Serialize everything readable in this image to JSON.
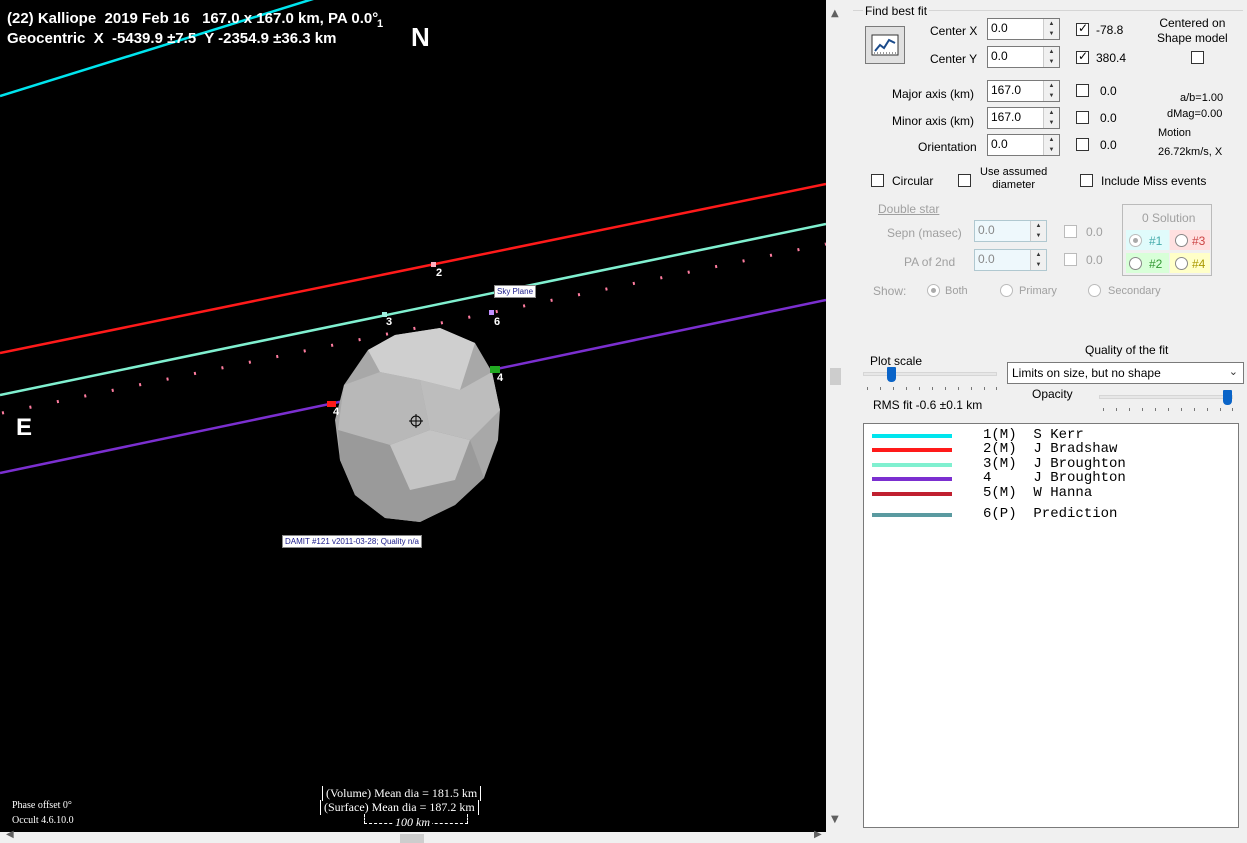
{
  "plot": {
    "header_line1": "(22) Kalliope  2019 Feb 16   167.0 x 167.0 km, PA 0.0°",
    "header_line2": "Geocentric  X  -5439.9 ±7.5  Y -2354.9 ±36.3 km",
    "north": "N",
    "east": "E",
    "sky_plane_label": "Sky Plane",
    "shape_label": "DAMIT #121 v2011-03-28; Quality n/a",
    "chord_labels": [
      "1",
      "2",
      "3",
      "4",
      "4",
      "4",
      "6"
    ],
    "volume_dia": "(Volume) Mean dia = 181.5 km",
    "surface_dia": "(Surface) Mean dia = 187.2 km",
    "scale_bar": "100 km",
    "phase_offset": "Phase offset 0°",
    "version": "Occult 4.6.10.0"
  },
  "panel": {
    "find_best_fit": "Find best fit",
    "center_x_label": "Center X",
    "center_x_value": "0.0",
    "center_x_result": "-78.8",
    "center_y_label": "Center Y",
    "center_y_value": "0.0",
    "center_y_result": "380.4",
    "centered_on_shape": "Centered on\nShape model",
    "major_axis_label": "Major axis (km)",
    "major_axis_value": "167.0",
    "major_axis_result": "0.0",
    "minor_axis_label": "Minor axis (km)",
    "minor_axis_value": "167.0",
    "minor_axis_result": "0.0",
    "orientation_label": "Orientation",
    "orientation_value": "0.0",
    "orientation_result": "0.0",
    "ab_ratio": "a/b=1.00",
    "dmag": "dMag=0.00",
    "motion_label": "Motion",
    "motion_value": "26.72km/s, X",
    "circular": "Circular",
    "use_assumed": "Use assumed\ndiameter",
    "include_miss": "Include Miss events",
    "double_star": "Double star",
    "sepn_label": "Sepn (masec)",
    "sepn_value": "0.0",
    "sepn_result": "0.0",
    "pa2_label": "PA of 2nd",
    "pa2_value": "0.0",
    "pa2_result": "0.0",
    "solution_title": "0 Solution",
    "sol1": "#1",
    "sol2": "#2",
    "sol3": "#3",
    "sol4": "#4",
    "show_label": "Show:",
    "show_both": "Both",
    "show_primary": "Primary",
    "show_secondary": "Secondary",
    "plot_scale": "Plot scale",
    "quality_title": "Quality of the fit",
    "quality_value": "Limits on size, but no shape",
    "opacity": "Opacity",
    "rms_fit": "RMS fit -0.6 ±0.1 km"
  },
  "legend": [
    {
      "text": "1(M)  S Kerr",
      "color": "#00e5ee"
    },
    {
      "text": "2(M)  J Bradshaw",
      "color": "#ff1a1a"
    },
    {
      "text": "3(M)  J Broughton",
      "color": "#80f0d0"
    },
    {
      "text": "4     J Broughton",
      "color": "#7b2fd0"
    },
    {
      "text": "5(M)  W Hanna",
      "color": "#c02030"
    },
    {
      "text": "6(P)  Prediction",
      "color": "#5a9aa0"
    }
  ],
  "colors": {
    "chord1": "#00e5ee",
    "chord2": "#ff1a1a",
    "chord3": "#80f0d0",
    "chord4": "#7b2fd0",
    "prediction_dots": "#ff7da0"
  }
}
